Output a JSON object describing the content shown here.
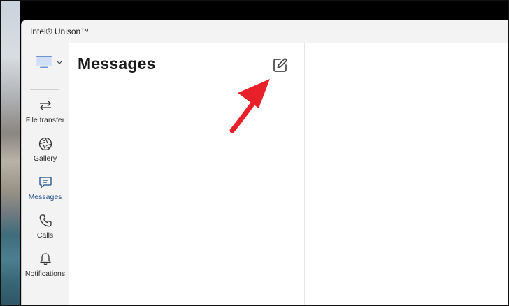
{
  "window": {
    "title": "Intel® Unison™"
  },
  "sidebar": {
    "items": [
      {
        "label": "File transfer",
        "icon": "swap-arrows-icon",
        "active": false
      },
      {
        "label": "Gallery",
        "icon": "aperture-icon",
        "active": false
      },
      {
        "label": "Messages",
        "icon": "chat-icon",
        "active": true
      },
      {
        "label": "Calls",
        "icon": "phone-icon",
        "active": false
      },
      {
        "label": "Notifications",
        "icon": "bell-icon",
        "active": false
      }
    ]
  },
  "messages": {
    "title": "Messages",
    "compose_icon": "compose-icon"
  },
  "colors": {
    "accent": "#1f4e8c",
    "annotation_arrow": "#e8202a"
  }
}
